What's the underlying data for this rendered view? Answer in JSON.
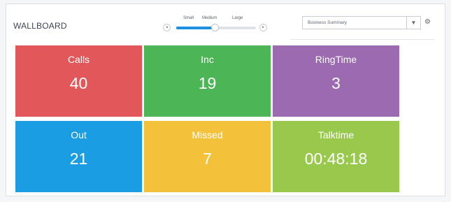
{
  "header": {
    "title": "WALLBOARD"
  },
  "size_slider": {
    "labels": [
      "Small",
      "Medium",
      "Large"
    ],
    "selected": "Medium",
    "prev_glyph": "◂",
    "next_glyph": "▸"
  },
  "view_select": {
    "value": "Business Summary",
    "caret_glyph": "▼",
    "settings_glyph": "⚙"
  },
  "tiles": [
    {
      "label": "Calls",
      "value": "40",
      "color": "#e2585a"
    },
    {
      "label": "Inc",
      "value": "19",
      "color": "#4cb657"
    },
    {
      "label": "RingTime",
      "value": "3",
      "color": "#9b6ab0"
    },
    {
      "label": "Out",
      "value": "21",
      "color": "#1b9de3"
    },
    {
      "label": "Missed",
      "value": "7",
      "color": "#f4c13a"
    },
    {
      "label": "Talktime",
      "value": "00:48:18",
      "color": "#98c94d"
    }
  ]
}
